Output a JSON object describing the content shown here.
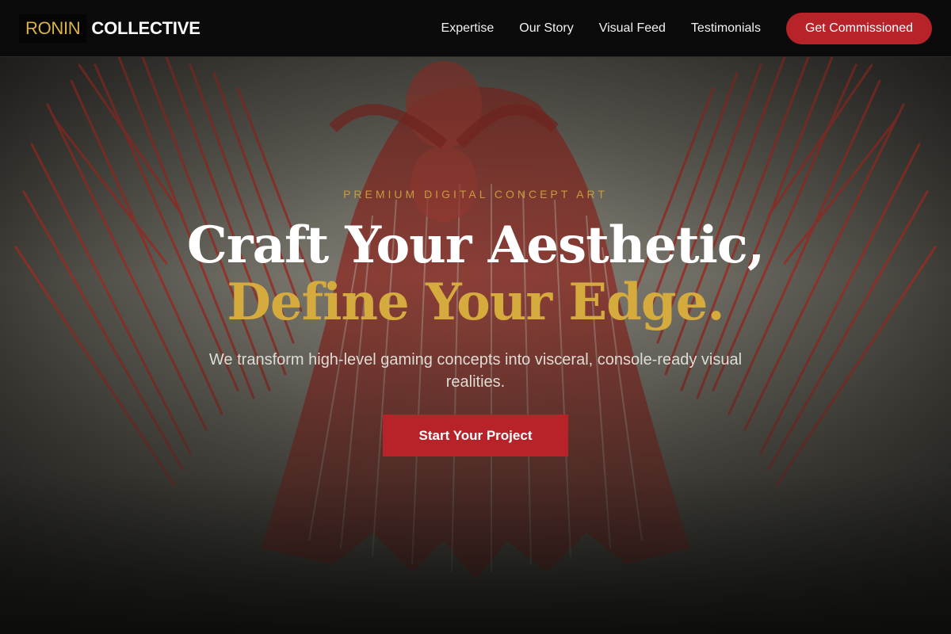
{
  "brand": {
    "part1": "RONIN",
    "part2": "COLLECTIVE"
  },
  "nav": {
    "links": [
      "Expertise",
      "Our Story",
      "Visual Feed",
      "Testimonials"
    ],
    "cta": "Get Commissioned"
  },
  "hero": {
    "eyebrow": "PREMIUM DIGITAL CONCEPT ART",
    "headline_line1": "Craft Your Aesthetic,",
    "headline_line2": "Define Your Edge.",
    "subtitle": "We transform high-level gaming concepts into visceral, console-ready visual realities.",
    "cta": "Start Your Project"
  },
  "colors": {
    "accent_gold": "#d6ab3e",
    "accent_red": "#b8232a",
    "header_bg": "#0b0b0b"
  }
}
